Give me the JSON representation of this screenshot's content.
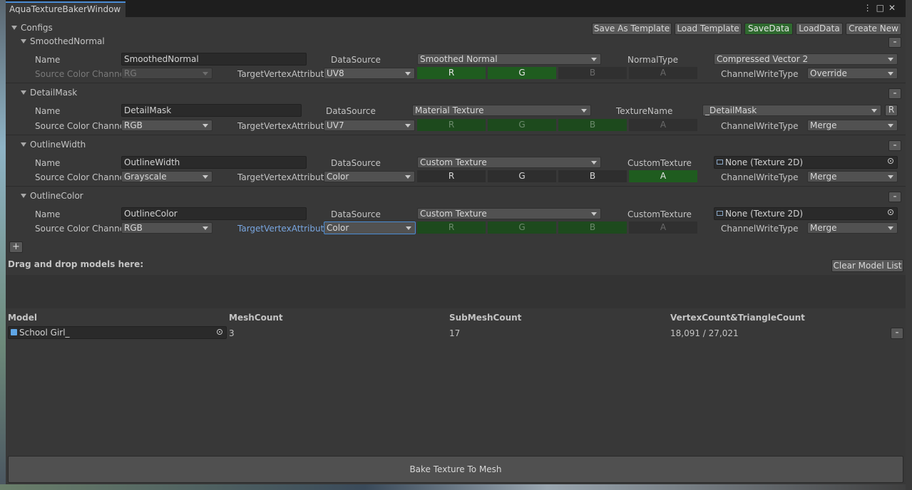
{
  "window": {
    "tab_title": "AquaTextureBakerWindow",
    "menu_icon": "kebab-icon",
    "maximize_icon": "maximize-icon",
    "close_icon": "close-icon"
  },
  "toolbar": {
    "configs_label": "Configs",
    "save_template": "Save As Template",
    "load_template": "Load Template",
    "save_data": "SaveData",
    "load_data": "LoadData",
    "create_new": "Create New"
  },
  "configs": [
    {
      "title": "SmoothedNormal",
      "name_label": "Name",
      "name_value": "SmoothedNormal",
      "datasource_label": "DataSource",
      "datasource_value": "Smoothed Normal",
      "extra_label": "NormalType",
      "extra_value": "Compressed Vector 2",
      "source_label": "Source Color Channe",
      "source_value": "RG",
      "target_label": "TargetVertexAttribute",
      "target_value": "UV8",
      "channels": [
        "R",
        "G",
        "B",
        "A"
      ],
      "write_label": "ChannelWriteType",
      "write_value": "Override",
      "remove": "-"
    },
    {
      "title": "DetailMask",
      "name_label": "Name",
      "name_value": "DetailMask",
      "datasource_label": "DataSource",
      "datasource_value": "Material Texture",
      "extra_label": "TextureName",
      "extra_value": "_DetailMask",
      "extra_button": "R",
      "source_label": "Source Color Channe",
      "source_value": "RGB",
      "target_label": "TargetVertexAttribute",
      "target_value": "UV7",
      "channels": [
        "R",
        "G",
        "B",
        "A"
      ],
      "write_label": "ChannelWriteType",
      "write_value": "Merge",
      "remove": "-"
    },
    {
      "title": "OutlineWidth",
      "name_label": "Name",
      "name_value": "OutlineWidth",
      "datasource_label": "DataSource",
      "datasource_value": "Custom Texture",
      "extra_label": "CustomTexture",
      "extra_value": "None (Texture 2D)",
      "source_label": "Source Color Channe",
      "source_value": "Grayscale",
      "target_label": "TargetVertexAttribute",
      "target_value": "Color",
      "channels": [
        "R",
        "G",
        "B",
        "A"
      ],
      "write_label": "ChannelWriteType",
      "write_value": "Merge",
      "remove": "-"
    },
    {
      "title": "OutlineColor",
      "name_label": "Name",
      "name_value": "OutlineColor",
      "datasource_label": "DataSource",
      "datasource_value": "Custom Texture",
      "extra_label": "CustomTexture",
      "extra_value": "None (Texture 2D)",
      "source_label": "Source Color Channe",
      "source_value": "RGB",
      "target_label": "TargetVertexAttribute",
      "target_value": "Color",
      "channels": [
        "R",
        "G",
        "B",
        "A"
      ],
      "write_label": "ChannelWriteType",
      "write_value": "Merge",
      "remove": "-"
    }
  ],
  "add_button": "+",
  "models": {
    "drop_label": "Drag and drop models here:",
    "clear_button": "Clear Model List",
    "headers": [
      "Model",
      "MeshCount",
      "SubMeshCount",
      "VertexCount&TriangleCount"
    ],
    "rows": [
      {
        "model": "School Girl_",
        "mesh_count": "3",
        "submesh_count": "17",
        "vertex_triangle": "18,091 / 27,021",
        "remove": "-"
      }
    ]
  },
  "bake_button": "Bake Texture To Mesh",
  "colors": {
    "accent": "#4a8cd4",
    "channel_on": "#1d4a1d",
    "save_green": "#2f6a2f"
  }
}
